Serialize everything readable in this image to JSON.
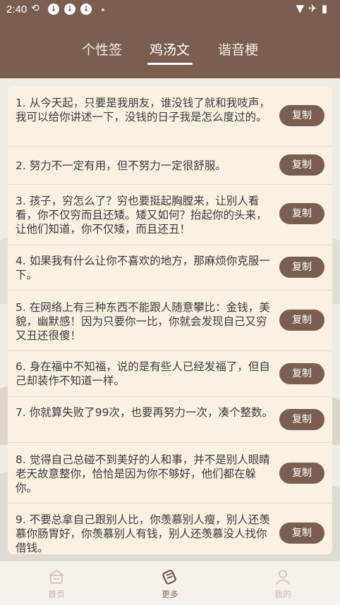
{
  "status_bar": {
    "time": "2:40",
    "icons": [
      "sync-off-icon",
      "download-icon",
      "download-icon",
      "download-icon",
      "dot-icon",
      "wifi-icon",
      "airplane-icon",
      "battery-icon"
    ]
  },
  "tabs": [
    {
      "label": "个性签",
      "active": false
    },
    {
      "label": "鸡汤文",
      "active": true
    },
    {
      "label": "谐音梗",
      "active": false
    }
  ],
  "items": [
    {
      "text": "1. 从今天起，只要是我朋友，谁没钱了就和我吱声，我可以给你讲述一下，没钱的日子我是怎么度过的。",
      "button": "复制"
    },
    {
      "text": "2. 努力不一定有用，但不努力一定很舒服。",
      "button": "复制"
    },
    {
      "text": "3. 孩子，穷怎么了？穷也要挺起胸膛来，让别人看看，你不仅穷而且还矮。矮又如何？抬起你的头来，让他们知道，你不仅矮，而且还丑！",
      "button": "复制"
    },
    {
      "text": "4. 如果我有什么让你不喜欢的地方，那麻烦你克服一下。",
      "button": "复制"
    },
    {
      "text": "5. 在网络上有三种东西不能跟人随意攀比：金钱，美貌，幽默感！因为只要你一比，你就会发现自己又穷又丑还很傻！",
      "button": "复制"
    },
    {
      "text": "6. 身在福中不知福，说的是有些人已经发福了，但自己却装作不知道一样。",
      "button": "复制"
    },
    {
      "text": "7. 你就算失败了99次，也要再努力一次，凑个整数。",
      "button": "复制"
    },
    {
      "text": "8. 觉得自己总碰不到美好的人和事，并不是别人眼睛老天故意整你，恰恰是因为你不够好，他们都在躲你。",
      "button": "复制"
    },
    {
      "text": "9. 不要总拿自己跟别人比，你羡慕别人瘦，别人还羡慕你肠胃好，你羡慕别人有钱，别人还羡慕没人找你借钱。",
      "button": "复制"
    }
  ],
  "bottom_nav": [
    {
      "label": "首页",
      "icon": "home-icon",
      "active": false
    },
    {
      "label": "更多",
      "icon": "scroll-icon",
      "active": true
    },
    {
      "label": "我的",
      "icon": "user-icon",
      "active": false
    }
  ],
  "colors": {
    "accent": "#7a5f50",
    "card": "#faf1e2",
    "background": "#f3efe6"
  }
}
